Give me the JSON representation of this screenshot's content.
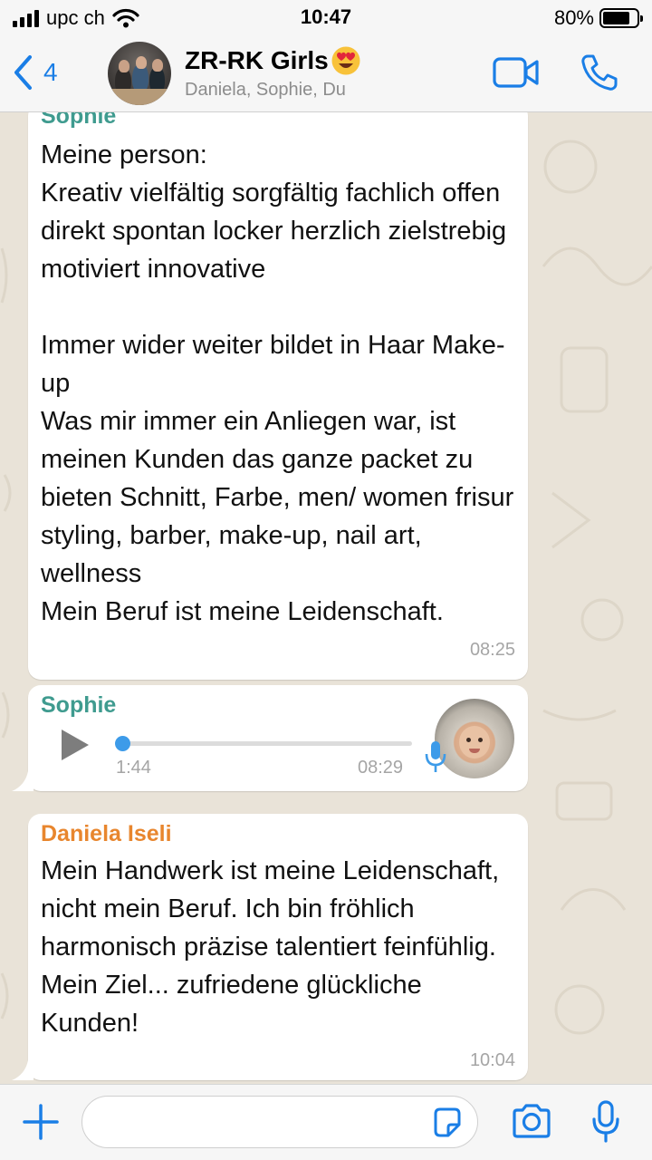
{
  "status_bar": {
    "carrier": "upc ch",
    "time": "10:47",
    "battery_percent": "80%",
    "battery_level": 0.8
  },
  "header": {
    "back_count": "4",
    "group_name": "ZR-RK Girls",
    "members": "Daniela, Sophie, Du",
    "icons": [
      "chevron-left-icon",
      "heart-eyes-emoji-icon",
      "video-camera-icon",
      "phone-icon"
    ]
  },
  "messages": [
    {
      "sender": "Sophie",
      "sender_color": "#3f9b8f",
      "text": "Meine person:\nKreativ vielfältig sorgfältig fachlich offen direkt spontan locker herzlich zielstrebig motiviert innovative\n\nImmer wider weiter bildet in Haar Make-up\nWas mir immer ein Anliegen war, ist meinen Kunden das ganze packet zu bieten Schnitt, Farbe, men/ women frisur styling, barber, make-up, nail art, wellness\nMein Beruf ist meine Leidenschaft.",
      "time": "08:25"
    },
    {
      "sender": "Sophie",
      "sender_color": "#3f9b8f",
      "type": "voice",
      "duration": "1:44",
      "time": "08:29",
      "progress": 0.0,
      "icons": [
        "play-icon",
        "microphone-icon"
      ]
    },
    {
      "sender": "Daniela Iseli",
      "sender_color": "#e8862e",
      "text": "Mein Handwerk ist meine Leidenschaft, nicht mein Beruf. Ich bin fröhlich harmonisch präzise talentiert feinfühlig. Mein Ziel... zufriedene glückliche Kunden!",
      "time": "10:04"
    }
  ],
  "input_bar": {
    "message_value": "",
    "message_placeholder": "",
    "icons": [
      "plus-icon",
      "sticker-icon",
      "camera-icon",
      "microphone-icon"
    ],
    "accent_color": "#1a7ee6"
  }
}
